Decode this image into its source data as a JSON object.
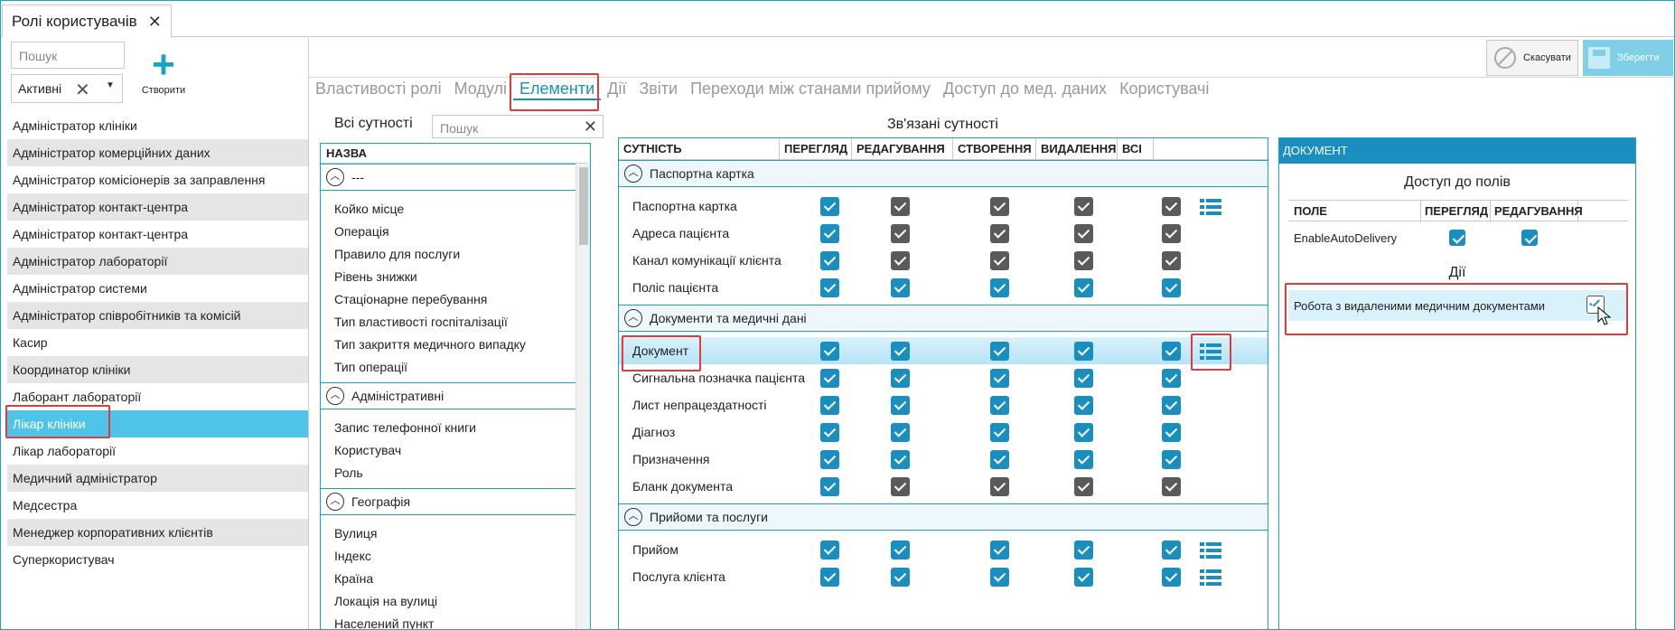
{
  "window": {
    "tab_title": "Ролі користувачів",
    "tab_close": "✕"
  },
  "left": {
    "search_placeholder": "Пошук",
    "filter_value": "Активні",
    "filter_clear": "✕",
    "filter_dropdown": "▼",
    "create_label": "Створити",
    "create_icon": "+",
    "roles": [
      "Адміністратор клініки",
      "Адміністратор комерційних даних",
      "Адміністратор комісіонерів за заправлення",
      "Адміністратор контакт-центра",
      "Адміністратор контакт-центра",
      "Адміністратор лабораторії",
      "Адміністратор системи",
      "Адміністратор співробітників та комісій",
      "Касир",
      "Координатор клініки",
      "Лаборант лабораторії",
      "Лікар клініки",
      "Лікар лабораторії",
      "Медичний адміністратор",
      "Медсестра",
      "Менеджер корпоративних клієнтів",
      "Суперкористувач"
    ],
    "selected_role": "Лікар клініки"
  },
  "toolbar": {
    "cancel_label": "Скасувати",
    "save_label": "Зберегти"
  },
  "subtabs": [
    "Властивості ролі",
    "Модулі",
    "Елементи",
    "Дії",
    "Звіти",
    "Переходи між станами прийому",
    "Доступ до мед. даних",
    "Користувачі"
  ],
  "active_subtab": "Елементи",
  "entities": {
    "title": "Всі сутності",
    "search_placeholder": "Пошук",
    "search_clear": "✕",
    "column": "НАЗВА",
    "groups": [
      {
        "name": "---",
        "items": [
          "Койко місце",
          "Операція",
          "Правило для послуги",
          "Рівень знижки",
          "Стаціонарне перебування",
          "Тип властивості госпіталізації",
          "Тип закриття медичного випадку",
          "Тип операції"
        ]
      },
      {
        "name": "Адміністративні",
        "items": [
          "Запис телефонної книги",
          "Користувач",
          "Роль"
        ]
      },
      {
        "name": "Географія",
        "items": [
          "Вулиця",
          "Індекс",
          "Країна",
          "Локація на вулиці",
          "Населений пункт"
        ]
      }
    ]
  },
  "related": {
    "title": "Зв'язані сутності",
    "columns": [
      "СУТНІСТЬ",
      "ПЕРЕГЛЯД",
      "РЕДАГУВАННЯ",
      "СТВОРЕННЯ",
      "ВИДАЛЕННЯ",
      "ВСІ"
    ],
    "groups": [
      {
        "name": "Паспортна картка",
        "rows": [
          {
            "name": "Паспортна картка",
            "checks": [
              "b",
              "g",
              "g",
              "g",
              "g"
            ],
            "list": true
          },
          {
            "name": "Адреса пацієнта",
            "checks": [
              "b",
              "g",
              "g",
              "g",
              "g"
            ],
            "list": false
          },
          {
            "name": "Канал комунікації клієнта",
            "checks": [
              "b",
              "g",
              "g",
              "g",
              "g"
            ],
            "list": false
          },
          {
            "name": "Поліс пацієнта",
            "checks": [
              "b",
              "b",
              "b",
              "b",
              "b"
            ],
            "list": false
          }
        ]
      },
      {
        "name": "Документи та медичні дані",
        "rows": [
          {
            "name": "Документ",
            "checks": [
              "b",
              "b",
              "b",
              "b",
              "b"
            ],
            "list": true,
            "highlight": true
          },
          {
            "name": "Сигнальна позначка пацієнта",
            "checks": [
              "b",
              "b",
              "b",
              "b",
              "b"
            ],
            "list": false
          },
          {
            "name": "Лист непрацездатності",
            "checks": [
              "b",
              "b",
              "b",
              "b",
              "b"
            ],
            "list": false
          },
          {
            "name": "Діагноз",
            "checks": [
              "b",
              "b",
              "b",
              "b",
              "b"
            ],
            "list": false
          },
          {
            "name": "Призначення",
            "checks": [
              "b",
              "b",
              "b",
              "b",
              "b"
            ],
            "list": false
          },
          {
            "name": "Бланк документа",
            "checks": [
              "b",
              "g",
              "g",
              "g",
              "g"
            ],
            "list": false
          }
        ]
      },
      {
        "name": "Прийоми та послуги",
        "rows": [
          {
            "name": "Прийом",
            "checks": [
              "b",
              "b",
              "b",
              "b",
              "b"
            ],
            "list": true
          },
          {
            "name": "Послуга клієнта",
            "checks": [
              "b",
              "b",
              "b",
              "b",
              "b"
            ],
            "list": true
          }
        ]
      }
    ]
  },
  "document": {
    "header": "ДОКУМЕНТ",
    "fields_title": "Доступ до полів",
    "fields_columns": [
      "ПОЛЕ",
      "ПЕРЕГЛЯД",
      "РЕДАГУВАННЯ"
    ],
    "fields": [
      {
        "name": "EnableAutoDelivery",
        "view": true,
        "edit": true
      }
    ],
    "actions_title": "Дії",
    "actions": [
      {
        "name": "Робота з видаленими медичним документами",
        "checked": true
      }
    ]
  },
  "colors": {
    "accent": "#1a8fbf",
    "selected": "#4fc3e8",
    "highlight_box": "#e03a3a",
    "gray_check": "#5a5a5a"
  }
}
